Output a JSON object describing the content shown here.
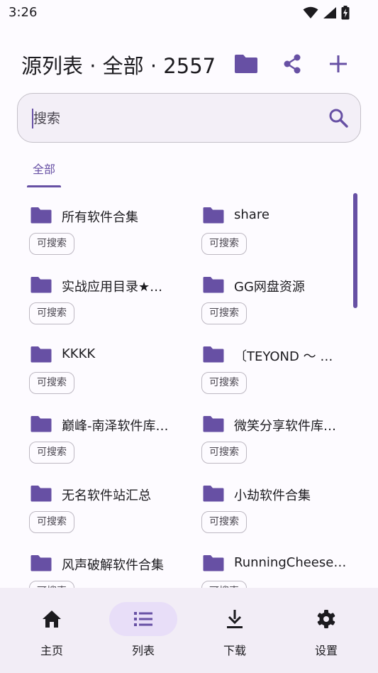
{
  "status_bar": {
    "time": "3:26",
    "icons": [
      "wifi-icon",
      "signal-icon",
      "battery-charging-icon"
    ]
  },
  "header": {
    "title": "源列表 · 全部 · 2557",
    "actions": [
      "folder-icon",
      "share-icon",
      "add-icon"
    ]
  },
  "search": {
    "placeholder": "搜索",
    "value": ""
  },
  "tabs": [
    {
      "label": "全部",
      "selected": true
    }
  ],
  "sources": [
    {
      "name": "所有软件合集",
      "tag": "可搜索"
    },
    {
      "name": "share",
      "tag": "可搜索"
    },
    {
      "name": "实战应用目录★…",
      "tag": "可搜索"
    },
    {
      "name": "GG网盘资源",
      "tag": "可搜索"
    },
    {
      "name": "KKKK",
      "tag": "可搜索"
    },
    {
      "name": "〔TEYOND ～ …",
      "tag": "可搜索"
    },
    {
      "name": "巅峰-南泽软件库…",
      "tag": "可搜索"
    },
    {
      "name": "微笑分享软件库…",
      "tag": "可搜索"
    },
    {
      "name": "无名软件站汇总",
      "tag": "可搜索"
    },
    {
      "name": "小劫软件合集",
      "tag": "可搜索"
    },
    {
      "name": "风声破解软件合集",
      "tag": "可搜索"
    },
    {
      "name": "RunningCheeseC…",
      "tag": "可搜索"
    }
  ],
  "bottom_nav": [
    {
      "label": "主页",
      "icon": "home-icon",
      "active": false
    },
    {
      "label": "列表",
      "icon": "list-icon",
      "active": true
    },
    {
      "label": "下载",
      "icon": "download-icon",
      "active": false
    },
    {
      "label": "设置",
      "icon": "settings-icon",
      "active": false
    }
  ],
  "colors": {
    "accent": "#6750a4",
    "nav_background": "#f2edf6",
    "active_pill": "#e8def8"
  }
}
